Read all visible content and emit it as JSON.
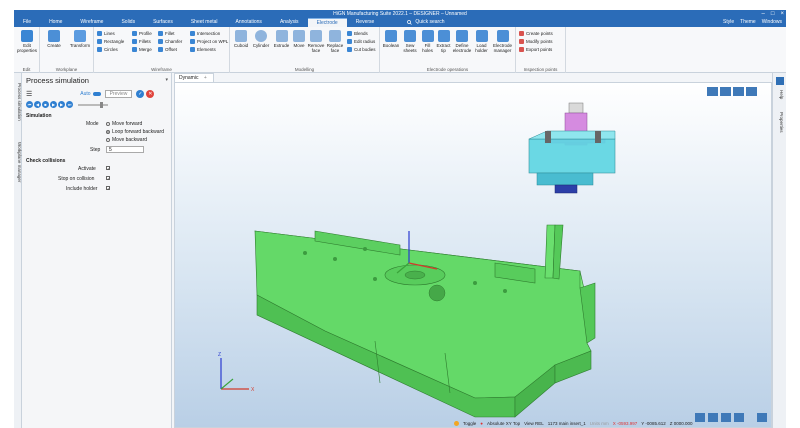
{
  "window": {
    "title": "HiGN Manufacturing Suite 2022.1 – DESIGNER – Unnamed"
  },
  "tabs": [
    {
      "label": "File"
    },
    {
      "label": "Home"
    },
    {
      "label": "Wireframe"
    },
    {
      "label": "Solids"
    },
    {
      "label": "Surfaces"
    },
    {
      "label": "Sheet metal"
    },
    {
      "label": "Annotations"
    },
    {
      "label": "Analysis"
    },
    {
      "label": "Electrode"
    },
    {
      "label": "Reverse"
    }
  ],
  "search_placeholder": "Quick search",
  "top_right": {
    "style": "Style",
    "theme": "Theme",
    "windows": "Windows"
  },
  "ribbon": {
    "edit": {
      "name": "Edit",
      "edit_properties": "Edit properties"
    },
    "workplane": {
      "name": "Workplane",
      "create": "Create",
      "transform": "Transform"
    },
    "wireframe": {
      "name": "Wireframe",
      "col1": [
        "Lines",
        "Rectangle",
        "Circles"
      ],
      "col2": [
        "Profile",
        "Fillets",
        "Merge"
      ],
      "col3": [
        "Fillet",
        "Chamfer",
        "Offset"
      ],
      "col4": [
        "Intersection",
        "Project on WPL",
        "Elements"
      ]
    },
    "modelling": {
      "name": "Modelling",
      "big": [
        "Cuboid",
        "Cylinder",
        "Extrude",
        "Move",
        "Remove face",
        "Replace face"
      ],
      "small": [
        "Blends",
        "Edit radius",
        "Cut bodies"
      ]
    },
    "electrode_ops": {
      "name": "Electrode operations",
      "big": [
        "Boolean",
        "Sew sheets",
        "Fill holes",
        "Extract tip",
        "Define electrode",
        "Load holder",
        "Electrode manager"
      ]
    },
    "inspection": {
      "name": "Inspection points",
      "small": [
        "Create points",
        "Modify points",
        "Export points"
      ]
    }
  },
  "side_tabs": [
    "Process simulation",
    "Workplane manager"
  ],
  "panel": {
    "title": "Process simulation",
    "auto_label": "Auto",
    "preview_label": "Preview",
    "simulation_heading": "Simulation",
    "mode_label": "Mode",
    "modes": [
      "Move forward",
      "Loop forward backward",
      "Move backward"
    ],
    "selected_mode": "Loop forward backward",
    "step_label": "Step",
    "step_value": "5",
    "check_heading": "Check collisions",
    "activate_label": "Activate",
    "stop_label": "Stop on collision",
    "holder_label": "Include holder"
  },
  "viewport": {
    "tab_label": "Dynamic",
    "add_tab": "+"
  },
  "right_tabs": [
    "Help",
    "Properties"
  ],
  "status": {
    "toggle": "Toggle",
    "abs": "Absolute XY Top",
    "view": "View REL",
    "count": "1173 main insert_1",
    "units": "Units mm",
    "x": "X -0593.997",
    "y": "Y -0085.612",
    "z": "Z 0000.000"
  },
  "colors": {
    "accent": "#2b6cb8",
    "green_part": "#66e26a",
    "electrode_cyan": "#5fd6e3",
    "holder_magenta": "#d58be0"
  }
}
